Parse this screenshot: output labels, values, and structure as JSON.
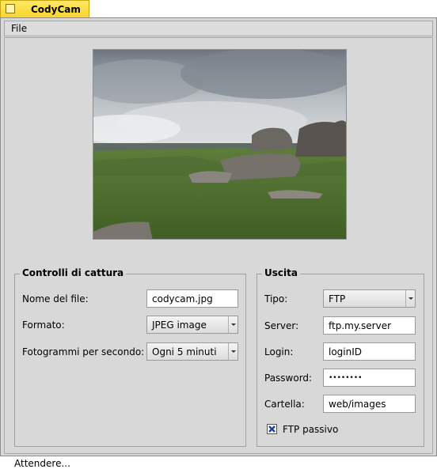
{
  "app": {
    "title": "CodyCam"
  },
  "menu": {
    "file": "File"
  },
  "capture": {
    "legend": "Controlli di cattura",
    "filename_label": "Nome del file:",
    "filename_value": "codycam.jpg",
    "format_label": "Formato:",
    "format_value": "JPEG image",
    "fps_label": "Fotogrammi per secondo:",
    "fps_value": "Ogni 5 minuti"
  },
  "output": {
    "legend": "Uscita",
    "type_label": "Tipo:",
    "type_value": "FTP",
    "server_label": "Server:",
    "server_value": "ftp.my.server",
    "login_label": "Login:",
    "login_value": "loginID",
    "password_label": "Password:",
    "password_value": "••••••••",
    "folder_label": "Cartella:",
    "folder_value": "web/images",
    "passive_label": "FTP passivo",
    "passive_checked": true
  },
  "status": {
    "text": "Attendere..."
  }
}
